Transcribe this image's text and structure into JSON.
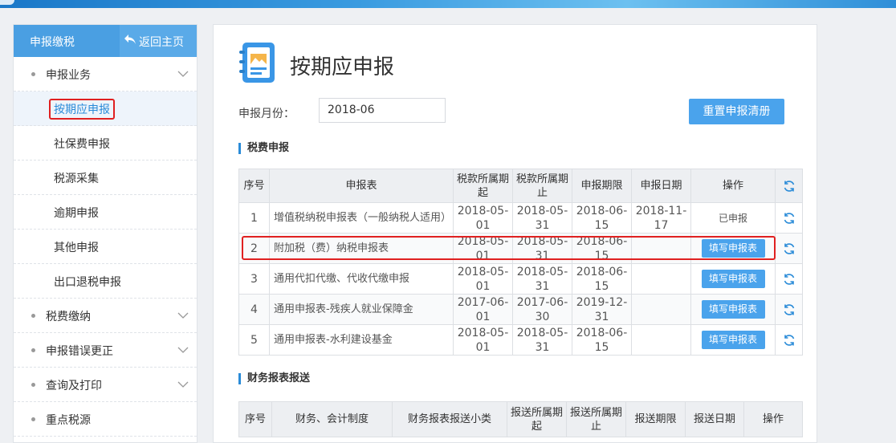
{
  "sidebar": {
    "title": "申报缴税",
    "back_label": "返回主页",
    "groups": [
      {
        "label": "申报业务"
      },
      {
        "label": "税费缴纳"
      },
      {
        "label": "申报错误更正"
      },
      {
        "label": "查询及打印"
      },
      {
        "label": "重点税源"
      }
    ],
    "sub_items": [
      {
        "label": "按期应申报"
      },
      {
        "label": "社保费申报"
      },
      {
        "label": "税源采集"
      },
      {
        "label": "逾期申报"
      },
      {
        "label": "其他申报"
      },
      {
        "label": "出口退税申报"
      }
    ]
  },
  "main": {
    "title": "按期应申报",
    "month_label": "申报月份：",
    "month_value": "2018-06",
    "reset_button": "重置申报清册",
    "section1_title": "税费申报",
    "section2_title": "财务报表报送"
  },
  "tax_table": {
    "headers": [
      "序号",
      "申报表",
      "税款所属期起",
      "税款所属期止",
      "申报期限",
      "申报日期",
      "操作"
    ],
    "rows": [
      {
        "no": "1",
        "name": "增值税纳税申报表（一般纳税人适用）",
        "start": "2018-05-01",
        "end": "2018-05-31",
        "deadline": "2018-06-15",
        "filed": "2018-11-17",
        "action": "已申报",
        "action_type": "status"
      },
      {
        "no": "2",
        "name": "附加税（费）纳税申报表",
        "start": "2018-05-01",
        "end": "2018-05-31",
        "deadline": "2018-06-15",
        "filed": "",
        "action": "填写申报表",
        "action_type": "button"
      },
      {
        "no": "3",
        "name": "通用代扣代缴、代收代缴申报",
        "start": "2018-05-01",
        "end": "2018-05-31",
        "deadline": "2018-06-15",
        "filed": "",
        "action": "填写申报表",
        "action_type": "button"
      },
      {
        "no": "4",
        "name": "通用申报表-残疾人就业保障金",
        "start": "2017-06-01",
        "end": "2017-06-30",
        "deadline": "2019-12-31",
        "filed": "",
        "action": "填写申报表",
        "action_type": "button"
      },
      {
        "no": "5",
        "name": "通用申报表-水利建设基金",
        "start": "2018-05-01",
        "end": "2018-05-31",
        "deadline": "2018-06-15",
        "filed": "",
        "action": "填写申报表",
        "action_type": "button"
      }
    ]
  },
  "finance_table": {
    "headers": [
      "序号",
      "财务、会计制度",
      "财务报表报送小类",
      "报送所属期起",
      "报送所属期止",
      "报送期限",
      "报送日期",
      "操作"
    ]
  },
  "colors": {
    "accent": "#4aa3ec",
    "sidebar_header": "#4a9fe2",
    "highlight": "#e02020"
  },
  "icons": {
    "back": "return-arrow-icon",
    "chevron": "chevron-down-icon",
    "refresh": "refresh-icon",
    "page": "notebook-icon"
  }
}
